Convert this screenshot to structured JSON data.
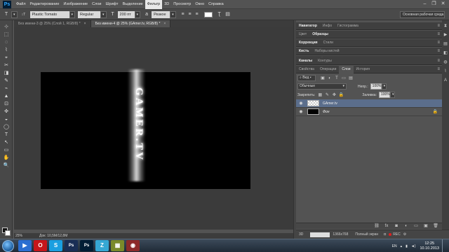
{
  "app": {
    "logo": "Ps"
  },
  "menu": {
    "items": [
      "Файл",
      "Редактирование",
      "Изображение",
      "Слои",
      "Шрифт",
      "Выделение",
      "Фильтр",
      "3D",
      "Просмотр",
      "Окно",
      "Справка"
    ],
    "active_index": 6
  },
  "window_controls": {
    "minimize": "–",
    "restore": "❐",
    "close": "✕"
  },
  "options_bar": {
    "tool_icon": "T",
    "orientation_icon": "↕T",
    "font_family": "Plastic Tomato",
    "font_style": "Regular",
    "size_icon": "T",
    "font_size": "200 пт",
    "aa_icon": "a",
    "antialias": "Резкое",
    "workspace": "Основная рабочая среда"
  },
  "tabs": [
    {
      "label": "Без имени-3 @ 25% (Слой 1, RGB/8) *",
      "active": false
    },
    {
      "label": "Без имени-4 @ 25% (GAmer.tv, RGB/8) *",
      "active": true
    }
  ],
  "tools": [
    "⊹",
    "⬚",
    "◌",
    "⌇",
    "⌖",
    "✂",
    "◨",
    "✎",
    "⌁",
    "▲",
    "⊡",
    "✜",
    "◒",
    "◯",
    "T",
    "↖",
    "▭",
    "✋",
    "🔍"
  ],
  "canvas": {
    "text": "GAMER.TV"
  },
  "status": {
    "zoom": "25%",
    "doc_size": "Док: 10,5M/12,8M"
  },
  "panels": {
    "group1": {
      "tabs": [
        "Навигатор",
        "Инфо",
        "Гистограмма"
      ],
      "active": 0
    },
    "group2": {
      "tabs": [
        "Цвет",
        "Образцы"
      ],
      "active": 1
    },
    "group3": {
      "tabs": [
        "Коррекция",
        "Стили"
      ],
      "active": 0
    },
    "group4": {
      "tabs": [
        "Кисть",
        "Наборы кистей"
      ],
      "active": 0
    },
    "group5": {
      "tabs": [
        "Символ",
        "Абзац"
      ],
      "active": 0
    },
    "group6": {
      "tabs": [
        "Каналы",
        "Контуры"
      ],
      "active": 0
    },
    "menu_icon": "≡"
  },
  "layers_panel": {
    "tabs": [
      "Свойства",
      "Операции",
      "Слои",
      "История"
    ],
    "active_tab": 2,
    "filter_label": "Вид",
    "blend_mode": "Обычные",
    "opacity_label": "Непр.:",
    "opacity_value": "100%",
    "lock_label": "Закрепить:",
    "fill_label": "Заливка:",
    "fill_value": "100%",
    "layers": [
      {
        "name": "GAmer.tv",
        "thumb": "text",
        "selected": true,
        "locked": false
      },
      {
        "name": "Фон",
        "thumb": "black",
        "selected": false,
        "locked": true
      }
    ],
    "footer_icons": [
      "link-icon",
      "fx-icon",
      "mask-icon",
      "adjustment-icon",
      "folder-icon",
      "new-layer-icon",
      "trash-icon"
    ]
  },
  "timeline": {
    "label": "3D",
    "resolution": "1366x768",
    "mode": "Полный экран",
    "rec": "REC"
  },
  "taskbar": {
    "apps": [
      {
        "name": "mediaplayer",
        "glyph": "▶",
        "color": "#2b6ed1"
      },
      {
        "name": "opera",
        "glyph": "O",
        "color": "#c6161b"
      },
      {
        "name": "skype",
        "glyph": "S",
        "color": "#1a9fe0"
      },
      {
        "name": "photoshop-doc",
        "glyph": "Ps",
        "color": "#1a2e55"
      },
      {
        "name": "photoshop",
        "glyph": "Ps",
        "color": "#001d34"
      },
      {
        "name": "z-app",
        "glyph": "Z",
        "color": "#35a7d4"
      },
      {
        "name": "image-viewer",
        "glyph": "▦",
        "color": "#7a8a2a"
      },
      {
        "name": "recorder",
        "glyph": "◉",
        "color": "#8c2a2a"
      }
    ],
    "lang": "EN",
    "time": "12:25",
    "date": "10.10.2013"
  },
  "colors": {
    "accent": "#31a8ff",
    "selected_layer": "#5b6e8c",
    "rec": "#e02020"
  }
}
